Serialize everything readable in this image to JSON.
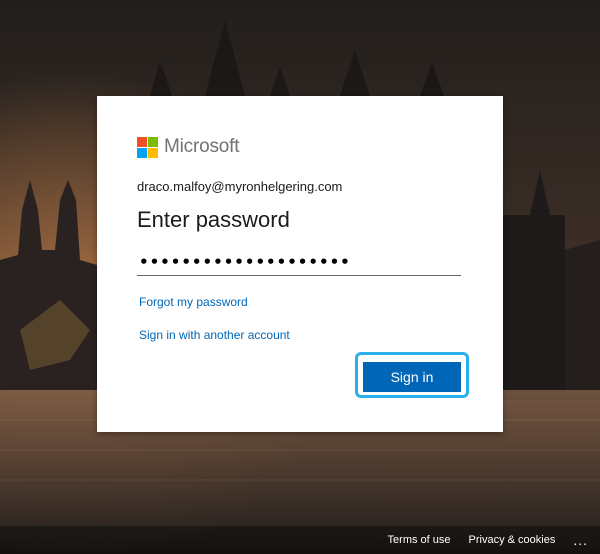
{
  "logo": {
    "text": "Microsoft",
    "colors": [
      "#f25022",
      "#7fba00",
      "#00a4ef",
      "#ffb900"
    ]
  },
  "account": {
    "email": "draco.malfoy@myronhelgering.com"
  },
  "page": {
    "title": "Enter password"
  },
  "password": {
    "value": "••••••••••••••••••••"
  },
  "links": {
    "forgot": "Forgot my password",
    "other_account": "Sign in with another account"
  },
  "buttons": {
    "sign_in": "Sign in"
  },
  "footer": {
    "terms": "Terms of use",
    "privacy": "Privacy & cookies",
    "more": "..."
  },
  "colors": {
    "accent": "#0067b8",
    "focus_ring": "#2ab0e8",
    "card": "#ffffff"
  },
  "icons": [
    "microsoft-logo-icon",
    "more-options-icon"
  ]
}
